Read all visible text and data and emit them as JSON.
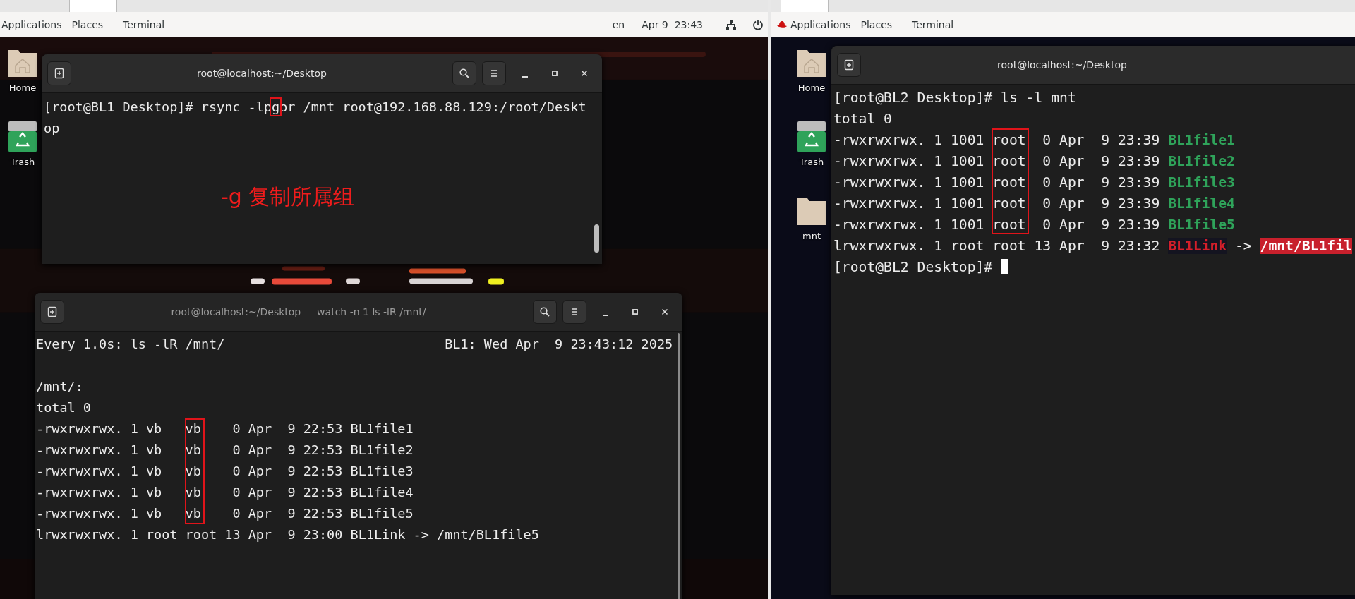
{
  "left_screen": {
    "top_bar": {
      "menus": [
        "Applications",
        "Places",
        "Terminal"
      ],
      "keyboard": "en",
      "clock": "Apr 9  23:43"
    },
    "desktop_icons": [
      {
        "label": "Home",
        "kind": "home"
      },
      {
        "label": "Trash",
        "kind": "trash"
      }
    ],
    "terminals": [
      {
        "title": "root@localhost:~/Desktop",
        "active": true,
        "lines": [
          "[root@BL1 Desktop]# rsync -lpgor /mnt root@192.168.88.129:/root/Deskt",
          "op"
        ],
        "annotation": "-g 复制所属组"
      },
      {
        "title": "root@localhost:~/Desktop — watch -n 1 ls -lR /mnt/",
        "active": false,
        "watch_header": "Every 1.0s: ls -lR /mnt/                            BL1: Wed Apr  9 23:43:12 2025",
        "lines": [
          "/mnt/:",
          "total 0",
          "-rwxrwxrwx. 1 vb   vb    0 Apr  9 22:53 BL1file1",
          "-rwxrwxrwx. 1 vb   vb    0 Apr  9 22:53 BL1file2",
          "-rwxrwxrwx. 1 vb   vb    0 Apr  9 22:53 BL1file3",
          "-rwxrwxrwx. 1 vb   vb    0 Apr  9 22:53 BL1file4",
          "-rwxrwxrwx. 1 vb   vb    0 Apr  9 22:53 BL1file5",
          "lrwxrwxrwx. 1 root root 13 Apr  9 23:00 BL1Link -> /mnt/BL1file5"
        ]
      }
    ]
  },
  "right_screen": {
    "top_bar": {
      "menus": [
        "Applications",
        "Places",
        "Terminal"
      ]
    },
    "desktop_icons": [
      {
        "label": "Home",
        "kind": "home"
      },
      {
        "label": "Trash",
        "kind": "trash"
      },
      {
        "label": "mnt",
        "kind": "folder"
      }
    ],
    "terminal": {
      "title": "root@localhost:~/Desktop",
      "lines": [
        {
          "cursor": false,
          "segments": [
            {
              "kind": "plain",
              "text": "[root@BL2 Desktop]# ls -l mnt"
            }
          ]
        },
        {
          "cursor": false,
          "segments": [
            {
              "kind": "plain",
              "text": "total 0"
            }
          ]
        },
        {
          "cursor": false,
          "segments": [
            {
              "kind": "plain",
              "text": "-rwxrwxrwx. 1 1001 root  0 Apr  9 23:39 "
            },
            {
              "kind": "file",
              "text": "BL1file1"
            }
          ]
        },
        {
          "cursor": false,
          "segments": [
            {
              "kind": "plain",
              "text": "-rwxrwxrwx. 1 1001 root  0 Apr  9 23:39 "
            },
            {
              "kind": "file",
              "text": "BL1file2"
            }
          ]
        },
        {
          "cursor": false,
          "segments": [
            {
              "kind": "plain",
              "text": "-rwxrwxrwx. 1 1001 root  0 Apr  9 23:39 "
            },
            {
              "kind": "file",
              "text": "BL1file3"
            }
          ]
        },
        {
          "cursor": false,
          "segments": [
            {
              "kind": "plain",
              "text": "-rwxrwxrwx. 1 1001 root  0 Apr  9 23:39 "
            },
            {
              "kind": "file",
              "text": "BL1file4"
            }
          ]
        },
        {
          "cursor": false,
          "segments": [
            {
              "kind": "plain",
              "text": "-rwxrwxrwx. 1 1001 root  0 Apr  9 23:39 "
            },
            {
              "kind": "file",
              "text": "BL1file5"
            }
          ]
        },
        {
          "cursor": false,
          "segments": [
            {
              "kind": "plain",
              "text": "lrwxrwxrwx. 1 root root 13 Apr  9 23:32 "
            },
            {
              "kind": "symlink",
              "text": "BL1Link"
            },
            {
              "kind": "plain",
              "text": " -> "
            },
            {
              "kind": "broken_target",
              "text": "/mnt/BL1fil"
            }
          ]
        },
        {
          "cursor": true,
          "segments": [
            {
              "kind": "plain",
              "text": "[root@BL2 Desktop]# "
            }
          ]
        }
      ]
    }
  }
}
